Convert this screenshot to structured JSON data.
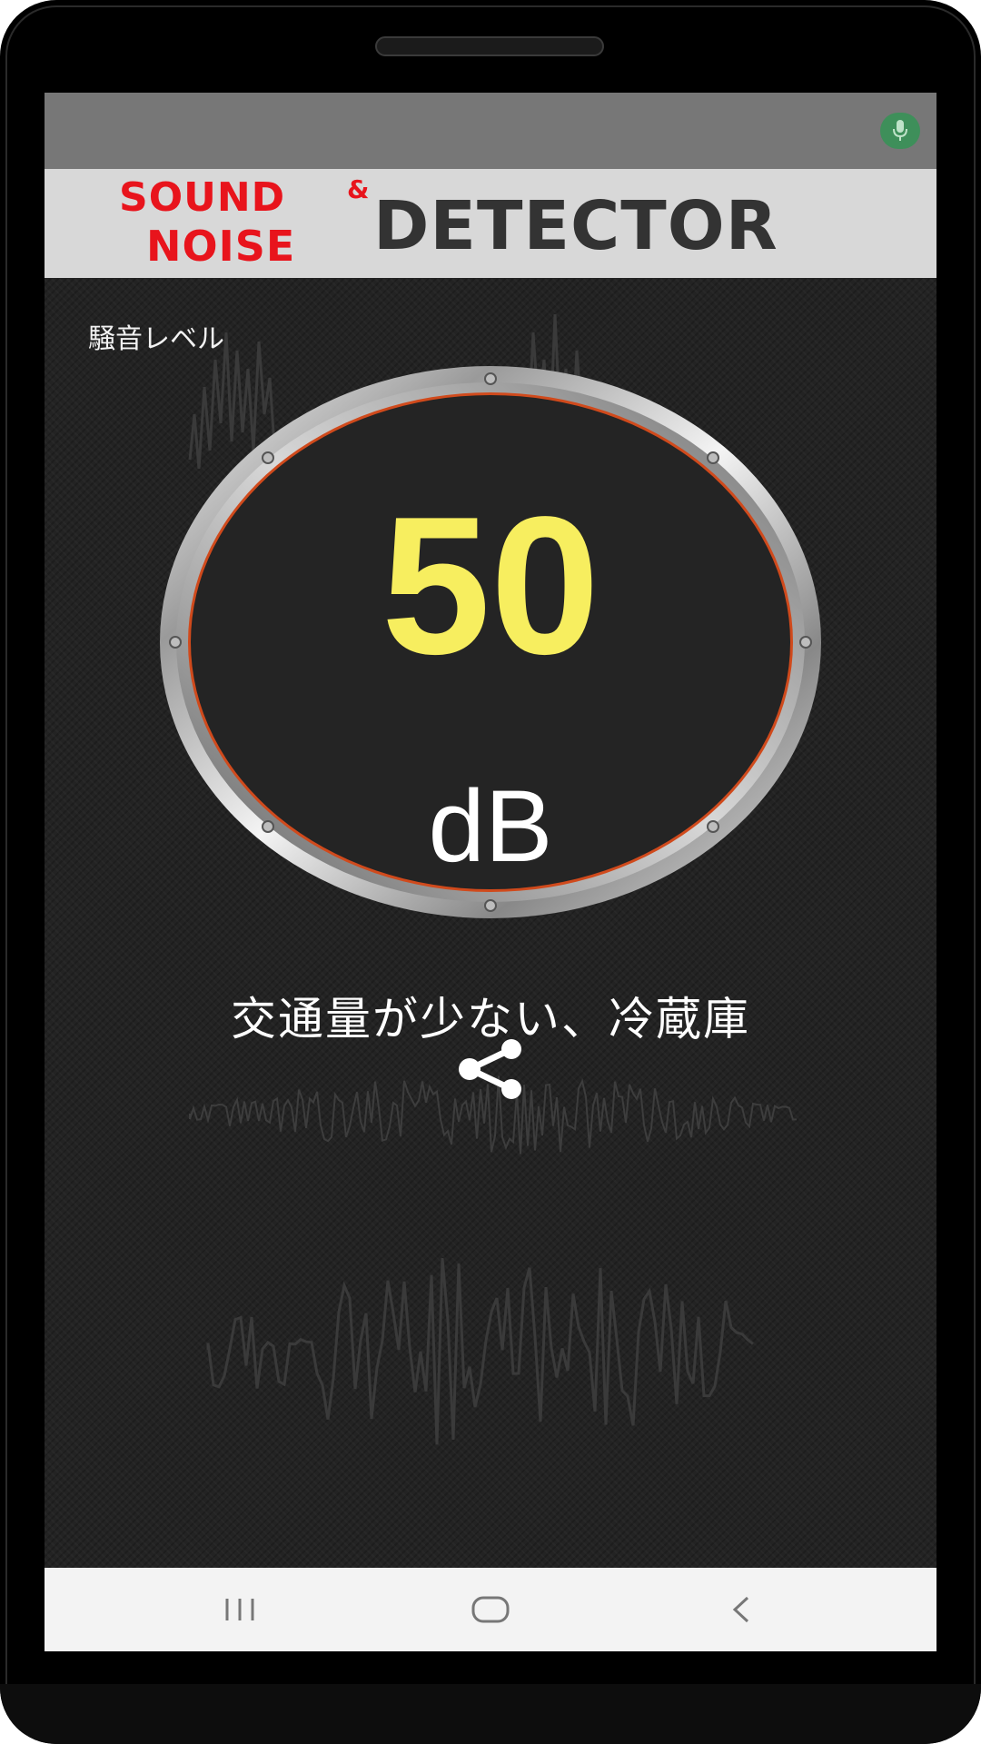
{
  "app": {
    "logo_sound": "SOUND",
    "logo_amp": "&",
    "logo_noise": "NOISE",
    "logo_detector": "DETECTOR"
  },
  "status": {
    "mic_icon": "microphone-icon",
    "mic_indicator_color": "#3e8f5a"
  },
  "meter": {
    "label": "騒音レベル",
    "value": "50",
    "unit": "dB",
    "description": "交通量が少ない、冷蔵庫",
    "share_icon": "share-icon",
    "value_color": "#f7ee5f"
  },
  "navbar": {
    "recents_icon": "recents-icon",
    "home_icon": "home-icon",
    "back_icon": "back-icon"
  },
  "colors": {
    "logo_red": "#e8141c",
    "logo_dark": "#333333",
    "background": "#232323"
  }
}
